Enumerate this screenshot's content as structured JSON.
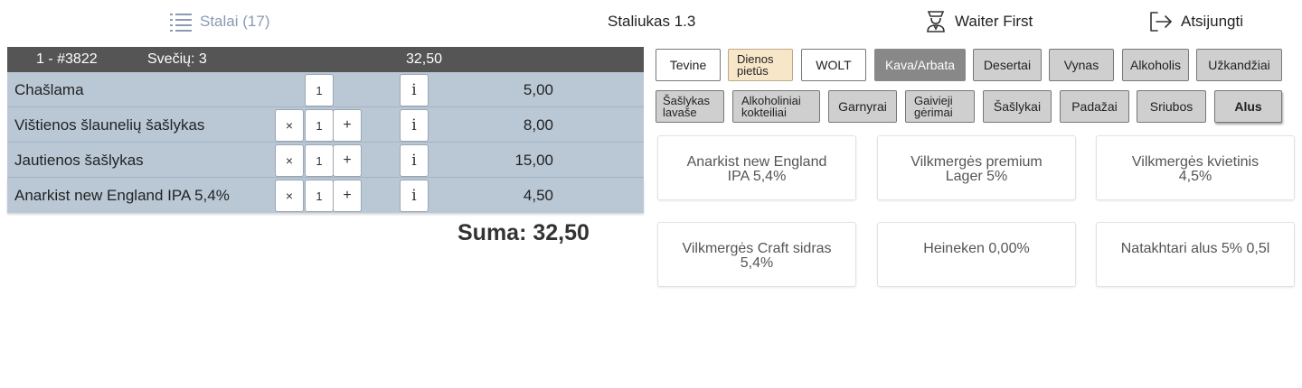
{
  "header": {
    "tables_label": "Stalai (17)",
    "title": "Staliukas 1.3",
    "waiter": "Waiter First",
    "logout": "Atsijungti"
  },
  "order": {
    "id": "1 - #3822",
    "guests": "Svečių: 3",
    "total": "32,50",
    "items": [
      {
        "name": "Chašlama",
        "qty": "1",
        "price": "5,00",
        "has_remove": false
      },
      {
        "name": "Vištienos šlaunelių šašlykas",
        "qty": "1",
        "price": "8,00",
        "has_remove": true
      },
      {
        "name": "Jautienos šašlykas",
        "qty": "1",
        "price": "15,00",
        "has_remove": true
      },
      {
        "name": "Anarkist new England IPA 5,4%",
        "qty": "1",
        "price": "4,50",
        "has_remove": true
      }
    ],
    "remove_symbol": "×",
    "plus_symbol": "+",
    "info_symbol": "i",
    "sum_label": "Suma: 32,50"
  },
  "categories_row1": [
    {
      "label": "Tevine",
      "style": "white"
    },
    {
      "label": "Dienos pietūs",
      "style": "beige"
    },
    {
      "label": "WOLT",
      "style": "white"
    },
    {
      "label": "Kava/Arbata",
      "style": "dark"
    },
    {
      "label": "Desertai",
      "style": "gray"
    },
    {
      "label": "Vynas",
      "style": "gray"
    },
    {
      "label": "Alkoholis",
      "style": "gray"
    },
    {
      "label": "Užkandžiai",
      "style": "gray"
    }
  ],
  "categories_row2": [
    {
      "label": "Šašlykas lavaše",
      "style": "gray"
    },
    {
      "label": "Alkoholiniai kokteiliai",
      "style": "gray"
    },
    {
      "label": "Garnyrai",
      "style": "gray"
    },
    {
      "label": "Gaivieji gėrimai",
      "style": "gray"
    },
    {
      "label": "Šašlykai",
      "style": "gray"
    },
    {
      "label": "Padažai",
      "style": "gray"
    },
    {
      "label": "Sriubos",
      "style": "gray"
    },
    {
      "label": "Alus",
      "style": "active"
    }
  ],
  "products": [
    {
      "line1": "Anarkist new England",
      "line2": "IPA 5,4%"
    },
    {
      "line1": "Vilkmergės premium",
      "line2": "Lager 5%"
    },
    {
      "line1": "Vilkmergės kvietinis",
      "line2": "4,5%"
    },
    {
      "line1": "Vilkmergės Craft sidras",
      "line2": "5,4%"
    },
    {
      "line1": "Heineken 0,00%",
      "line2": ""
    },
    {
      "line1": "Natakhtari alus 5% 0,5l",
      "line2": ""
    }
  ],
  "colors": {
    "header_link": "#8a9bb5",
    "order_header_bg": "#555555",
    "order_row_bg": "#bac8d6",
    "category_active_dark": "#888888",
    "category_beige": "#f8e6c8"
  }
}
